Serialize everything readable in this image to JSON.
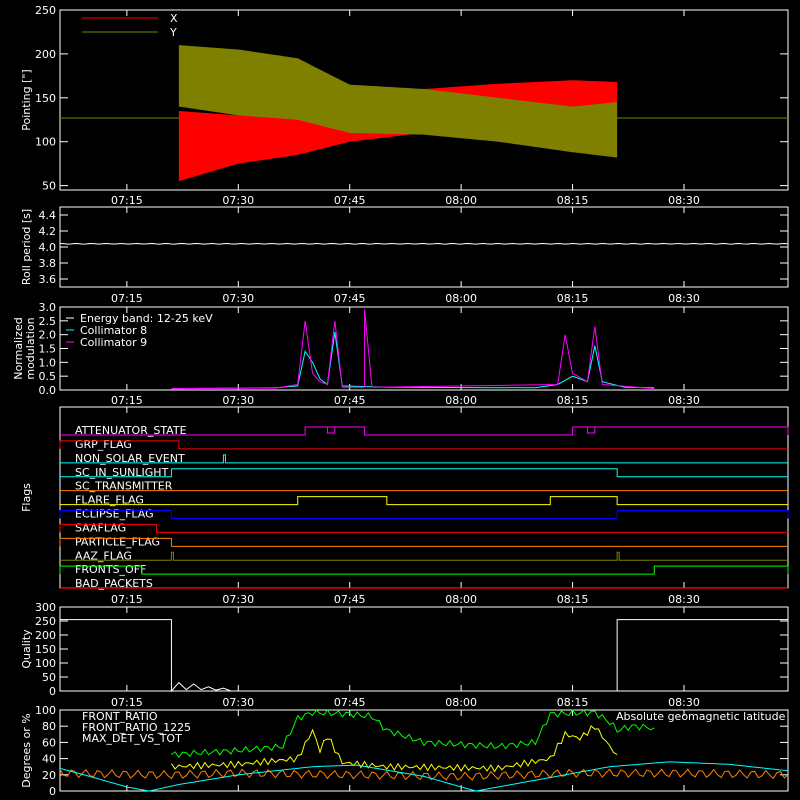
{
  "colors": {
    "background": "#000000",
    "axes": "#ffffff",
    "red": "#ff0000",
    "olive": "#808000",
    "cyan": "#00ffff",
    "magenta": "#ff00ff",
    "green": "#00ff00",
    "yellow": "#ffff00",
    "orange": "#ff8000",
    "blue": "#0000ff",
    "white": "#ffffff"
  },
  "time_ticks": [
    "07:15",
    "07:30",
    "07:45",
    "08:00",
    "08:15",
    "08:30"
  ],
  "chart_data": [
    {
      "id": "pointing",
      "type": "area",
      "ylabel": "Pointing [\"]",
      "ylim": [
        45,
        250
      ],
      "ytick_values": [
        50,
        100,
        150,
        200,
        250
      ],
      "ytick_labels": [
        "50",
        "100",
        "150",
        "200",
        "250"
      ],
      "legend": [
        "X",
        "Y"
      ],
      "legend_placement": "top-left",
      "x_range": [
        "07:06",
        "08:44"
      ],
      "series": [
        {
          "name": "X",
          "color": "red",
          "envelope": [
            {
              "t": "07:22",
              "lo": 55,
              "hi": 135
            },
            {
              "t": "07:30",
              "lo": 75,
              "hi": 130
            },
            {
              "t": "07:38",
              "lo": 85,
              "hi": 128
            },
            {
              "t": "07:45",
              "lo": 100,
              "hi": 145
            },
            {
              "t": "07:55",
              "lo": 110,
              "hi": 160
            },
            {
              "t": "08:05",
              "lo": 112,
              "hi": 166
            },
            {
              "t": "08:15",
              "lo": 118,
              "hi": 170
            },
            {
              "t": "08:21",
              "lo": 125,
              "hi": 168
            }
          ]
        },
        {
          "name": "Y",
          "color": "olive",
          "envelope": [
            {
              "t": "07:22",
              "lo": 140,
              "hi": 210
            },
            {
              "t": "07:30",
              "lo": 130,
              "hi": 205
            },
            {
              "t": "07:38",
              "lo": 125,
              "hi": 195
            },
            {
              "t": "07:45",
              "lo": 110,
              "hi": 165
            },
            {
              "t": "07:55",
              "lo": 108,
              "hi": 160
            },
            {
              "t": "08:05",
              "lo": 100,
              "hi": 150
            },
            {
              "t": "08:15",
              "lo": 88,
              "hi": 140
            },
            {
              "t": "08:21",
              "lo": 82,
              "hi": 145
            }
          ]
        }
      ],
      "baseline": {
        "value": 127,
        "color": "olive"
      }
    },
    {
      "id": "roll",
      "type": "line",
      "ylabel": "Roll period [s]",
      "ylim": [
        3.5,
        4.5
      ],
      "ytick_values": [
        3.6,
        3.8,
        4.0,
        4.2,
        4.4
      ],
      "ytick_labels": [
        "3.6",
        "3.8",
        "4.0",
        "4.2",
        "4.4"
      ],
      "series": [
        {
          "color": "white",
          "value": 4.04
        }
      ]
    },
    {
      "id": "modulation",
      "type": "line",
      "ylabel": "Normalized modulation",
      "ylim": [
        0,
        3.0
      ],
      "ytick_values": [
        0,
        0.5,
        1.0,
        1.5,
        2.0,
        2.5,
        3.0
      ],
      "ytick_labels": [
        "0.0",
        "0.5",
        "1.0",
        "1.5",
        "2.0",
        "2.5",
        "3.0"
      ],
      "legend": [
        "Energy band: 12-25 keV",
        "Collimator 8",
        "Collimator 9"
      ],
      "legend_placement": "top-left",
      "series": [
        {
          "name": "Collimator 8",
          "color": "cyan",
          "points": [
            [
              "07:21",
              0.05
            ],
            [
              "07:35",
              0.08
            ],
            [
              "07:38",
              0.15
            ],
            [
              "07:39",
              1.4
            ],
            [
              "07:40",
              1.0
            ],
            [
              "07:41",
              0.4
            ],
            [
              "07:42",
              0.2
            ],
            [
              "07:43",
              2.1
            ],
            [
              "07:44",
              0.15
            ],
            [
              "07:50",
              0.1
            ],
            [
              "08:10",
              0.08
            ],
            [
              "08:13",
              0.2
            ],
            [
              "08:15",
              0.5
            ],
            [
              "08:17",
              0.3
            ],
            [
              "08:18",
              1.6
            ],
            [
              "08:19",
              0.3
            ],
            [
              "08:22",
              0.1
            ],
            [
              "08:26",
              0.08
            ]
          ]
        },
        {
          "name": "Collimator 9",
          "color": "magenta",
          "points": [
            [
              "07:21",
              0.05
            ],
            [
              "07:35",
              0.07
            ],
            [
              "07:38",
              0.2
            ],
            [
              "07:39",
              2.5
            ],
            [
              "07:40",
              0.6
            ],
            [
              "07:41",
              0.3
            ],
            [
              "07:42",
              0.2
            ],
            [
              "07:43",
              2.5
            ],
            [
              "07:44",
              0.1
            ],
            [
              "07:47",
              0.1
            ],
            [
              "07:47",
              2.9
            ],
            [
              "07:48",
              0.1
            ],
            [
              "08:13",
              0.2
            ],
            [
              "08:14",
              2.0
            ],
            [
              "08:15",
              0.6
            ],
            [
              "08:17",
              0.3
            ],
            [
              "08:18",
              2.3
            ],
            [
              "08:19",
              0.2
            ],
            [
              "08:26",
              0.05
            ]
          ]
        }
      ]
    },
    {
      "id": "flags",
      "type": "line",
      "ylabel": "Flags",
      "flags": [
        {
          "name": "ATTENUATOR_STATE",
          "color": "magenta",
          "high": [
            [
              "07:39",
              "07:47"
            ],
            [
              "08:15",
              "08:44"
            ]
          ],
          "dips": [
            [
              "07:42",
              "07:43"
            ],
            [
              "08:17",
              "08:18"
            ]
          ]
        },
        {
          "name": "GRP_FLAG",
          "color": "red",
          "high": [
            [
              "07:06",
              "07:22"
            ]
          ]
        },
        {
          "name": "NON_SOLAR_EVENT",
          "color": "cyan",
          "high": [
            [
              "07:28",
              "07:28"
            ]
          ]
        },
        {
          "name": "SC_IN_SUNLIGHT",
          "color": "cyan",
          "high": [
            [
              "07:21",
              "08:21"
            ]
          ]
        },
        {
          "name": "SC_TRANSMITTER",
          "color": "orange",
          "high": []
        },
        {
          "name": "FLARE_FLAG",
          "color": "yellow",
          "high": [
            [
              "07:38",
              "07:50"
            ],
            [
              "08:12",
              "08:21"
            ]
          ]
        },
        {
          "name": "ECLIPSE_FLAG",
          "color": "blue",
          "high": [
            [
              "07:06",
              "07:21"
            ],
            [
              "08:21",
              "08:44"
            ]
          ]
        },
        {
          "name": "SAAFLAG",
          "color": "red",
          "high": [
            [
              "07:06",
              "07:19"
            ]
          ]
        },
        {
          "name": "PARTICLE_FLAG",
          "color": "orange",
          "high": [
            [
              "07:06",
              "07:21"
            ]
          ]
        },
        {
          "name": "AAZ_FLAG",
          "color": "olive",
          "high": [
            [
              "07:21",
              "07:21"
            ],
            [
              "08:21",
              "08:21"
            ]
          ]
        },
        {
          "name": "FRONTS_OFF",
          "color": "green",
          "high": [
            [
              "07:06",
              "07:17"
            ],
            [
              "08:26",
              "08:44"
            ]
          ]
        },
        {
          "name": "BAD_PACKETS",
          "color": "red",
          "high": []
        }
      ]
    },
    {
      "id": "quality",
      "type": "line",
      "ylabel": "Quality",
      "ylim": [
        0,
        300
      ],
      "ytick_values": [
        0,
        50,
        100,
        150,
        200,
        250,
        300
      ],
      "ytick_labels": [
        "0",
        "50",
        "100",
        "150",
        "200",
        "250",
        "300"
      ],
      "series": [
        {
          "color": "white",
          "points": [
            [
              "07:06",
              255
            ],
            [
              "07:21",
              255
            ],
            [
              "07:21",
              0
            ],
            [
              "07:22",
              30
            ],
            [
              "07:23",
              5
            ],
            [
              "07:24",
              25
            ],
            [
              "07:25",
              5
            ],
            [
              "07:26",
              15
            ],
            [
              "07:27",
              3
            ],
            [
              "07:28",
              10
            ],
            [
              "07:29",
              0
            ],
            [
              "08:21",
              0
            ],
            [
              "08:21",
              255
            ],
            [
              "08:44",
              255
            ]
          ]
        }
      ]
    },
    {
      "id": "ratios",
      "type": "line",
      "ylabel": "Degrees or %",
      "ylim": [
        0,
        100
      ],
      "ytick_values": [
        0,
        20,
        40,
        60,
        80,
        100
      ],
      "ytick_labels": [
        "0",
        "20",
        "40",
        "60",
        "80",
        "100"
      ],
      "legend": [
        "FRONT_RATIO",
        "FRONT_RATIO_1225",
        "MAX_DET_VS_TOT"
      ],
      "legend_placement": "top-left",
      "right_label": "Absolute geomagnetic latitude",
      "series": [
        {
          "name": "FRONT_RATIO",
          "color": "yellow",
          "points": [
            [
              "07:21",
              30
            ],
            [
              "07:30",
              33
            ],
            [
              "07:38",
              40
            ],
            [
              "07:40",
              75
            ],
            [
              "07:41",
              50
            ],
            [
              "07:42",
              68
            ],
            [
              "07:44",
              35
            ],
            [
              "07:50",
              30
            ],
            [
              "08:05",
              28
            ],
            [
              "08:12",
              40
            ],
            [
              "08:14",
              70
            ],
            [
              "08:16",
              65
            ],
            [
              "08:18",
              80
            ],
            [
              "08:20",
              55
            ],
            [
              "08:21",
              45
            ]
          ]
        },
        {
          "name": "FRONT_RATIO_1225",
          "color": "green",
          "points": [
            [
              "07:21",
              45
            ],
            [
              "07:30",
              50
            ],
            [
              "07:36",
              55
            ],
            [
              "07:38",
              90
            ],
            [
              "07:40",
              97
            ],
            [
              "07:45",
              95
            ],
            [
              "07:48",
              92
            ],
            [
              "07:50",
              75
            ],
            [
              "07:55",
              60
            ],
            [
              "08:05",
              55
            ],
            [
              "08:10",
              60
            ],
            [
              "08:12",
              95
            ],
            [
              "08:18",
              97
            ],
            [
              "08:20",
              85
            ],
            [
              "08:21",
              75
            ],
            [
              "08:23",
              80
            ],
            [
              "08:26",
              78
            ]
          ]
        },
        {
          "name": "MAX_DET_VS_TOT",
          "color": "orange",
          "points": [
            [
              "07:06",
              22
            ],
            [
              "07:21",
              20
            ],
            [
              "07:30",
              22
            ],
            [
              "07:45",
              20
            ],
            [
              "08:00",
              18
            ],
            [
              "08:15",
              22
            ],
            [
              "08:30",
              22
            ],
            [
              "08:44",
              20
            ]
          ]
        },
        {
          "name": "Absolute geomagnetic latitude",
          "color": "cyan",
          "points": [
            [
              "07:06",
              28
            ],
            [
              "07:10",
              18
            ],
            [
              "07:15",
              5
            ],
            [
              "07:18",
              0
            ],
            [
              "07:22",
              8
            ],
            [
              "07:30",
              20
            ],
            [
              "07:40",
              30
            ],
            [
              "07:46",
              32
            ],
            [
              "07:55",
              18
            ],
            [
              "08:00",
              5
            ],
            [
              "08:02",
              0
            ],
            [
              "08:08",
              10
            ],
            [
              "08:20",
              30
            ],
            [
              "08:28",
              36
            ],
            [
              "08:36",
              33
            ],
            [
              "08:44",
              25
            ]
          ]
        }
      ]
    }
  ]
}
